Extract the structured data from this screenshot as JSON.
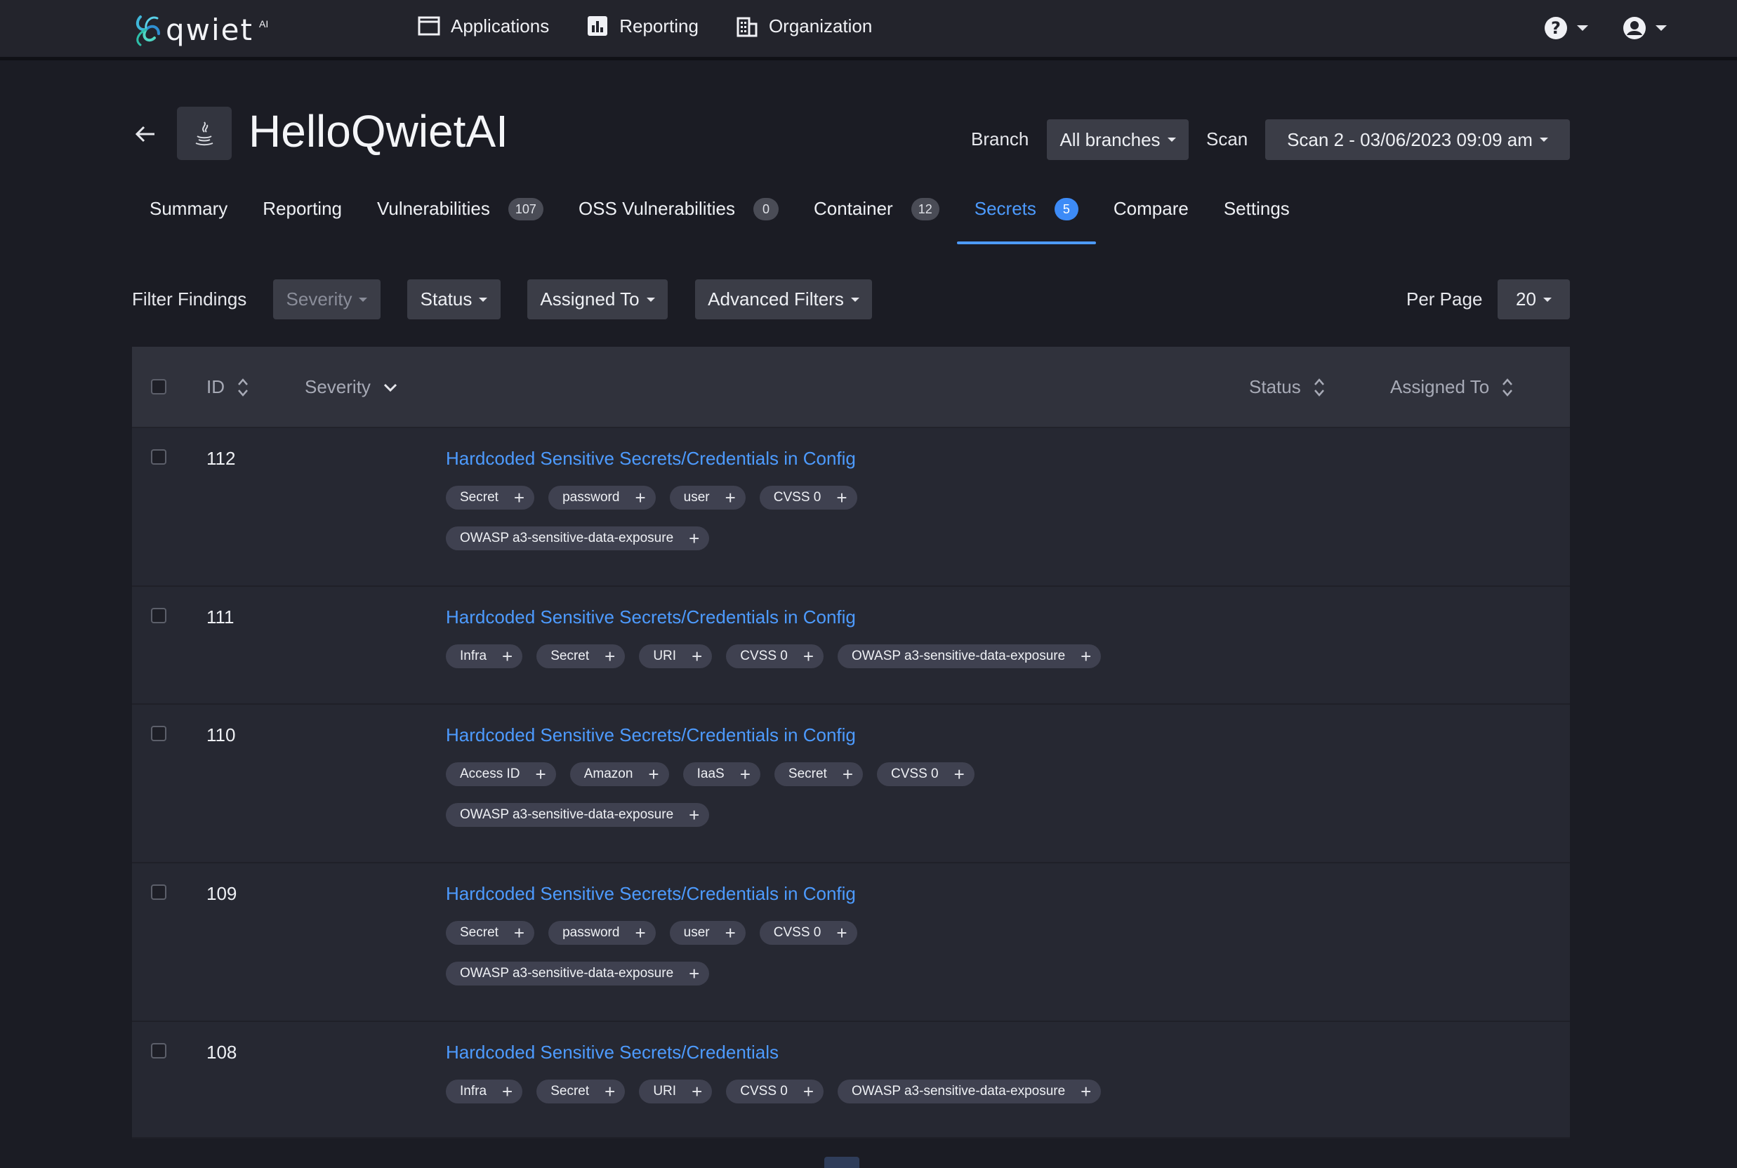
{
  "nav": {
    "logo": "qwiet",
    "logo_sup": "AI",
    "links": [
      "Applications",
      "Reporting",
      "Organization"
    ]
  },
  "header": {
    "title": "HelloQwietAI",
    "branch_label": "Branch",
    "branch_value": "All branches",
    "scan_label": "Scan",
    "scan_value": "Scan 2 - 03/06/2023 09:09 am"
  },
  "tabs": [
    {
      "label": "Summary"
    },
    {
      "label": "Reporting"
    },
    {
      "label": "Vulnerabilities",
      "count": "107"
    },
    {
      "label": "OSS Vulnerabilities",
      "count": "0"
    },
    {
      "label": "Container",
      "count": "12"
    },
    {
      "label": "Secrets",
      "count": "5",
      "active": true
    },
    {
      "label": "Compare"
    },
    {
      "label": "Settings"
    }
  ],
  "filters": {
    "label": "Filter Findings",
    "severity": "Severity",
    "status": "Status",
    "assigned_to": "Assigned To",
    "advanced": "Advanced Filters",
    "per_page_label": "Per Page",
    "per_page_value": "20"
  },
  "table": {
    "headers": {
      "id": "ID",
      "severity": "Severity",
      "status": "Status",
      "assigned_to": "Assigned To"
    },
    "rows": [
      {
        "id": "112",
        "title": "Hardcoded Sensitive Secrets/Credentials in Config",
        "tags": [
          [
            "Secret",
            "password",
            "user",
            "CVSS 0"
          ],
          [
            "OWASP a3-sensitive-data-exposure"
          ]
        ]
      },
      {
        "id": "111",
        "title": "Hardcoded Sensitive Secrets/Credentials in Config",
        "tags": [
          [
            "Infra",
            "Secret",
            "URI",
            "CVSS 0",
            "OWASP a3-sensitive-data-exposure"
          ]
        ]
      },
      {
        "id": "110",
        "title": "Hardcoded Sensitive Secrets/Credentials in Config",
        "tags": [
          [
            "Access ID",
            "Amazon",
            "IaaS",
            "Secret",
            "CVSS 0"
          ],
          [
            "OWASP a3-sensitive-data-exposure"
          ]
        ]
      },
      {
        "id": "109",
        "title": "Hardcoded Sensitive Secrets/Credentials in Config",
        "tags": [
          [
            "Secret",
            "password",
            "user",
            "CVSS 0"
          ],
          [
            "OWASP a3-sensitive-data-exposure"
          ]
        ]
      },
      {
        "id": "108",
        "title": "Hardcoded Sensitive Secrets/Credentials",
        "tags": [
          [
            "Infra",
            "Secret",
            "URI",
            "CVSS 0",
            "OWASP a3-sensitive-data-exposure"
          ]
        ]
      }
    ]
  },
  "colors": {
    "accent": "#4d9bff",
    "background": "#1b1c24",
    "panel": "#262832"
  }
}
